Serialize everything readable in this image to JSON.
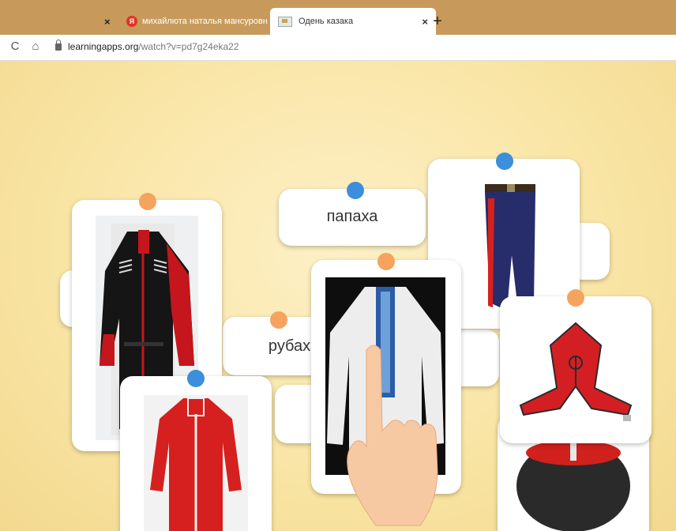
{
  "browser": {
    "tabs": [
      {
        "title": "",
        "close": "×"
      },
      {
        "title": "михайлюта наталья мансуровн",
        "close": "×",
        "icon": "yandex-icon",
        "icon_text": "Я"
      },
      {
        "title": "Одень казака",
        "close": "×",
        "icon": "learningapps-favicon"
      }
    ],
    "new_tab": "+",
    "nav": {
      "reload": "C",
      "home": "⌂"
    },
    "url": {
      "domain": "learningapps.org",
      "path": "/watch?v=pd7g24eka22"
    }
  },
  "app": {
    "cards": {
      "papakha_label": "папаха",
      "rubakha_label": "рубаха"
    },
    "colors": {
      "pin_orange": "#f5a35e",
      "pin_blue": "#3b8fdc",
      "background": "#f9e5a5"
    }
  }
}
